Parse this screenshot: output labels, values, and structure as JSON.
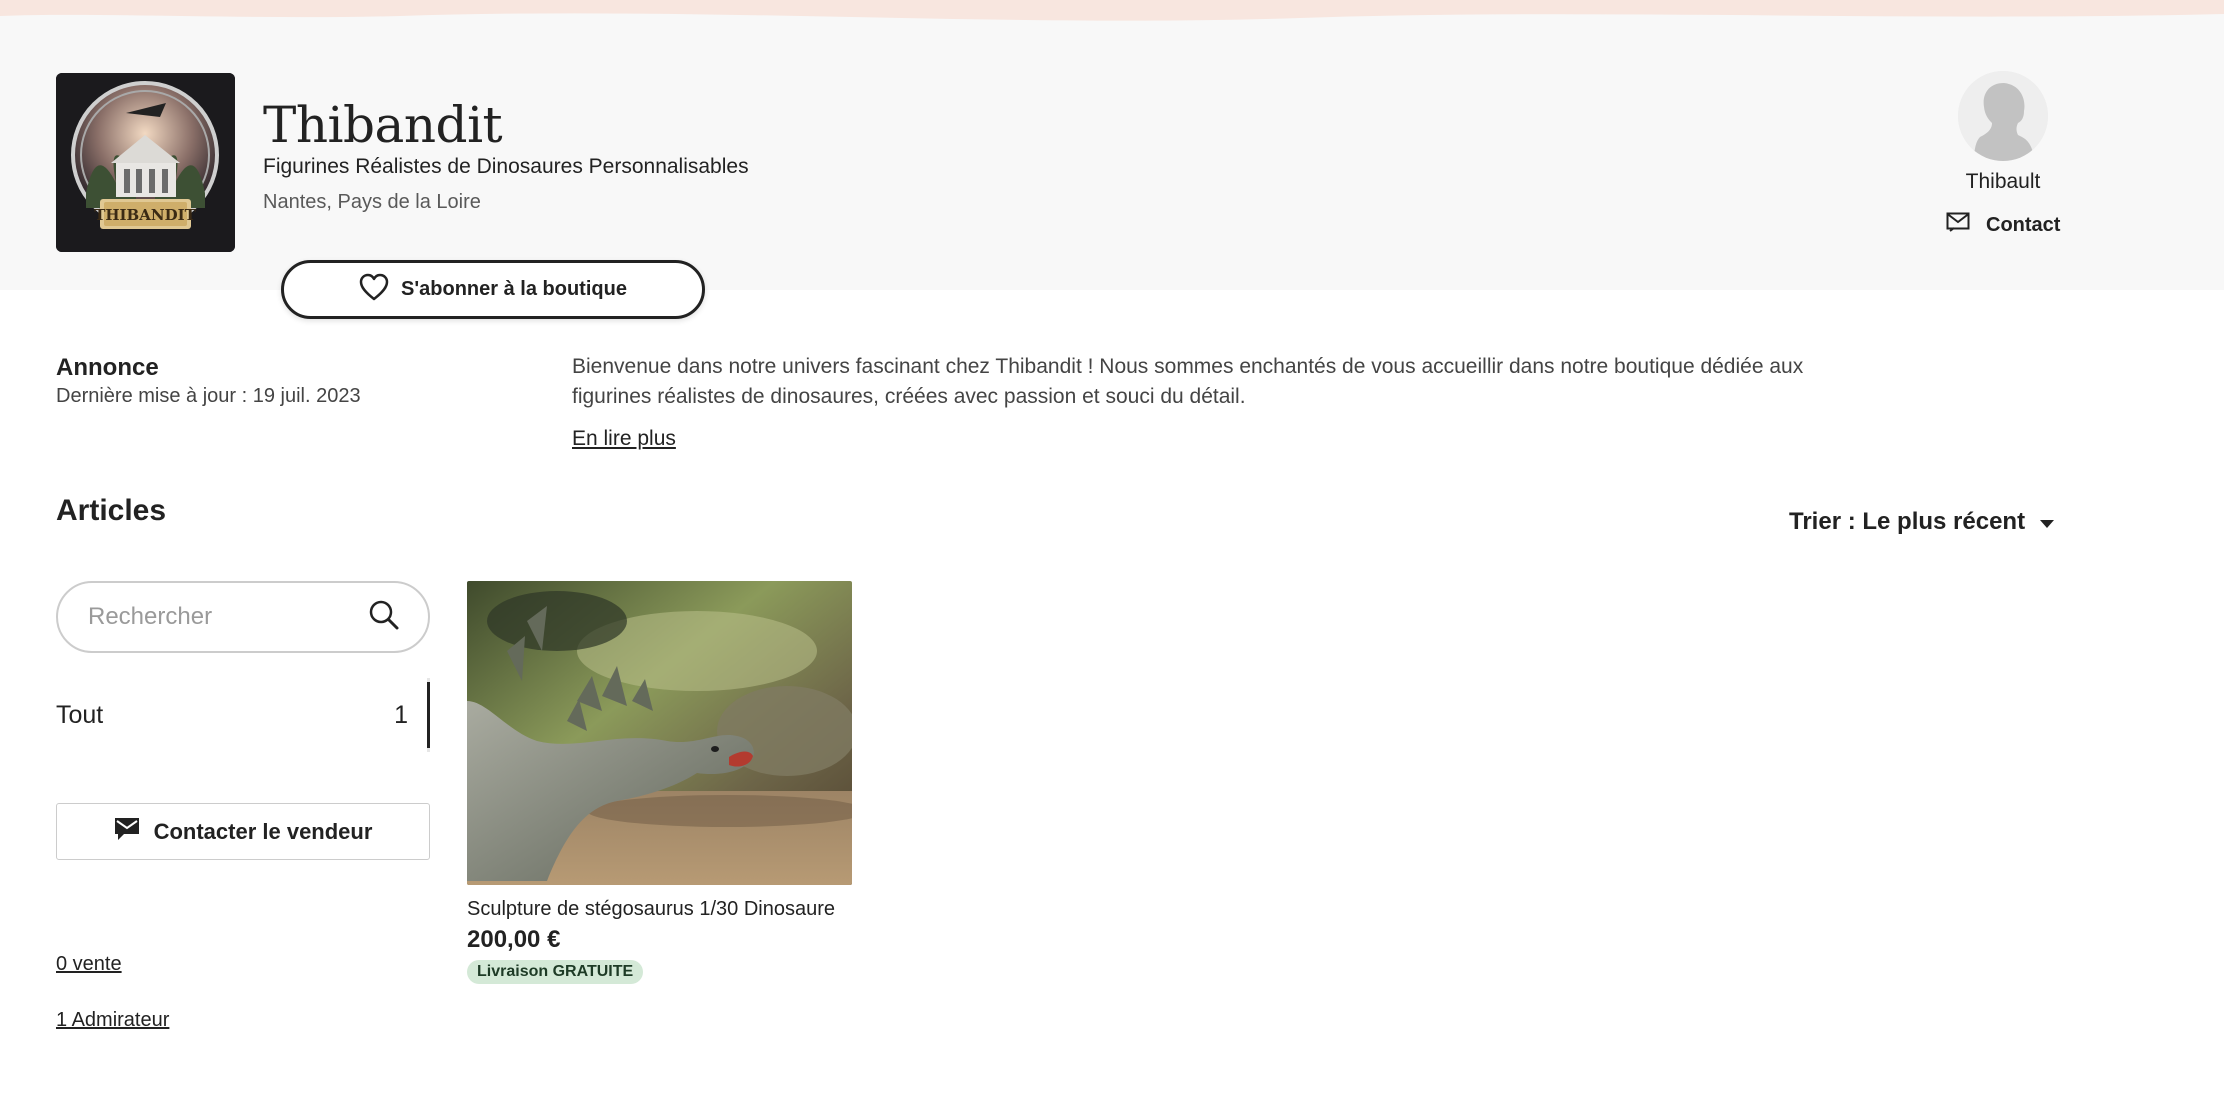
{
  "shop": {
    "name": "Thibandit",
    "tagline": "Figurines Réalistes de Dinosaures Personnalisables",
    "location": "Nantes, Pays de la Loire",
    "logo_text": "THIBANDIT",
    "follow_label": "S'abonner à la boutique"
  },
  "owner": {
    "name": "Thibault",
    "contact_label": "Contact"
  },
  "announcement": {
    "title": "Annonce",
    "updated": "Dernière mise à jour : 19 juil. 2023",
    "text": "Bienvenue dans notre univers fascinant chez Thibandit ! Nous sommes enchantés de vous accueillir dans notre boutique dédiée aux figurines réalistes de dinosaures, créées avec passion et souci du détail.",
    "read_more": "En lire plus"
  },
  "articles": {
    "title": "Articles",
    "sort_label": "Trier : Le plus récent",
    "search_placeholder": "Rechercher",
    "category": {
      "label": "Tout",
      "count": "1"
    },
    "contact_seller": "Contacter le vendeur",
    "sales": "0 vente",
    "admirers": "1 Admirateur"
  },
  "listings": [
    {
      "title": "Sculpture de stégosaurus 1/30 Dinosaure",
      "price": "200,00 €",
      "badge": "Livraison GRATUITE"
    }
  ],
  "icons": {
    "follow": "heart-icon",
    "contact": "mail-icon",
    "sort": "caret-down-icon",
    "search": "search-icon",
    "contact_seller": "message-icon"
  },
  "colors": {
    "header_band": "#f8f8f8",
    "wave": "#f8e6df",
    "badge_bg": "#d4e9d7",
    "text": "#222222"
  }
}
